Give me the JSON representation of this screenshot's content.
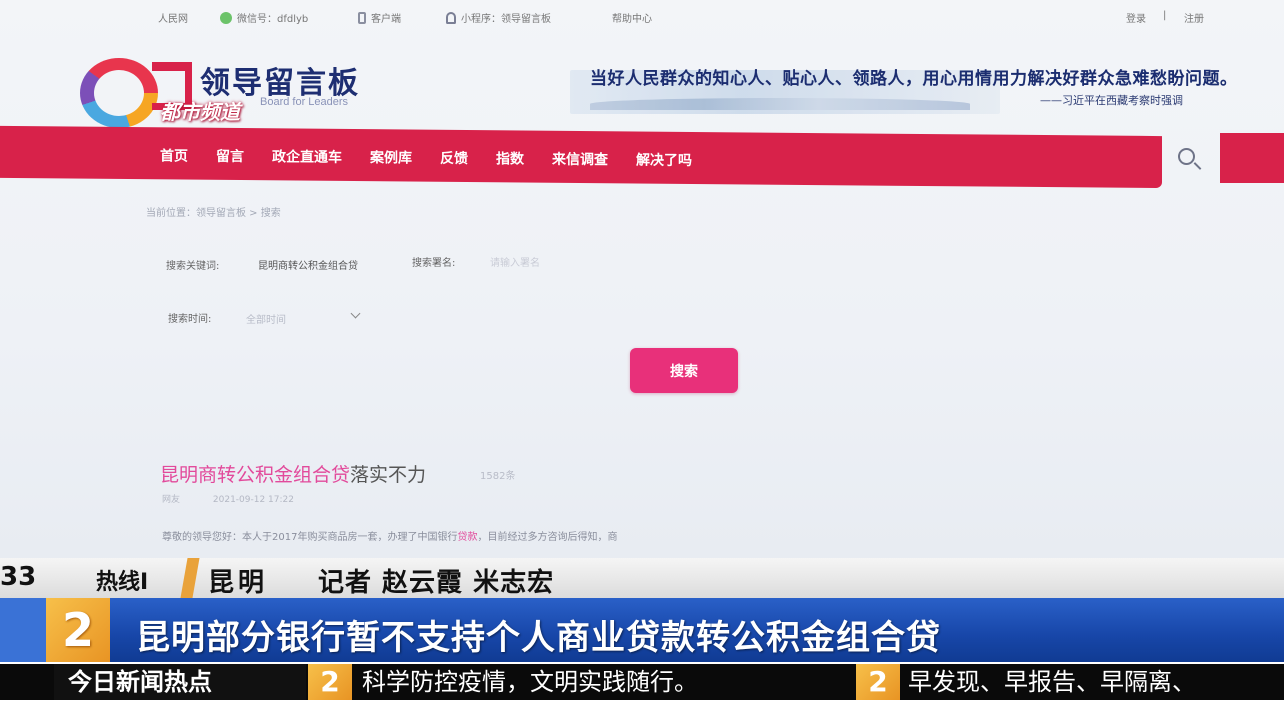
{
  "topbar": {
    "people": "人民网",
    "wechat": "微信号：dfdlyb",
    "client": "客户端",
    "miniprogram": "小程序：领导留言板",
    "help": "帮助中心",
    "login": "登录",
    "sep": "|",
    "register": "注册"
  },
  "header": {
    "site_name": "领导留言板",
    "site_name_en": "Board for Leaders",
    "channel_watermark": "都市频道",
    "quote": "当好人民群众的知心人、贴心人、领路人，用心用情用力解决好群众急难愁盼问题。",
    "quote_source": "——习近平在西藏考察时强调"
  },
  "nav": {
    "items": [
      "首页",
      "留言",
      "政企直通车",
      "案例库",
      "反馈",
      "指数",
      "来信调查",
      "解决了吗"
    ]
  },
  "breadcrumb": "当前位置：领导留言板 > 搜索",
  "search_form": {
    "keyword_label": "搜索关键词:",
    "keyword_value": "昆明商转公积金组合贷",
    "name_label": "搜索署名:",
    "name_placeholder": "请输入署名",
    "time_label": "搜索时间:",
    "time_value": "全部时间",
    "submit": "搜索"
  },
  "result": {
    "title_highlight": "昆明商转公积金组合贷",
    "title_rest": "落实不力",
    "count": "1582条",
    "author": "网友",
    "date": "2021-09-12 17:22",
    "snippet_a": "尊敬的领导您好：本人于2017年购买商品房一套，办理了中国银行",
    "snippet_hl": "贷款",
    "snippet_b": "，目前经过多方咨询后得知，商"
  },
  "overlay": {
    "channel_number": "33",
    "hotline": "热线Ⅰ",
    "location": "昆明",
    "reporter": "记者 赵云霞 米志宏",
    "logo_digit": "2",
    "headline": "昆明部分银行暂不支持个人商业贷款转公积金组合贷",
    "ticker_label": "今日新闻热点",
    "ticker_1": "科学防控疫情，文明实践随行。",
    "ticker_2": "早发现、早报告、早隔离、"
  },
  "colors": {
    "nav_red": "#d8224a",
    "search_pink": "#e8307a",
    "highlight_pink": "#e24a9b",
    "overlay_blue": "#1746a8",
    "overlay_orange": "#e89424"
  },
  "icons": [
    "wechat-icon",
    "phone-icon",
    "miniprogram-icon",
    "search-icon"
  ]
}
